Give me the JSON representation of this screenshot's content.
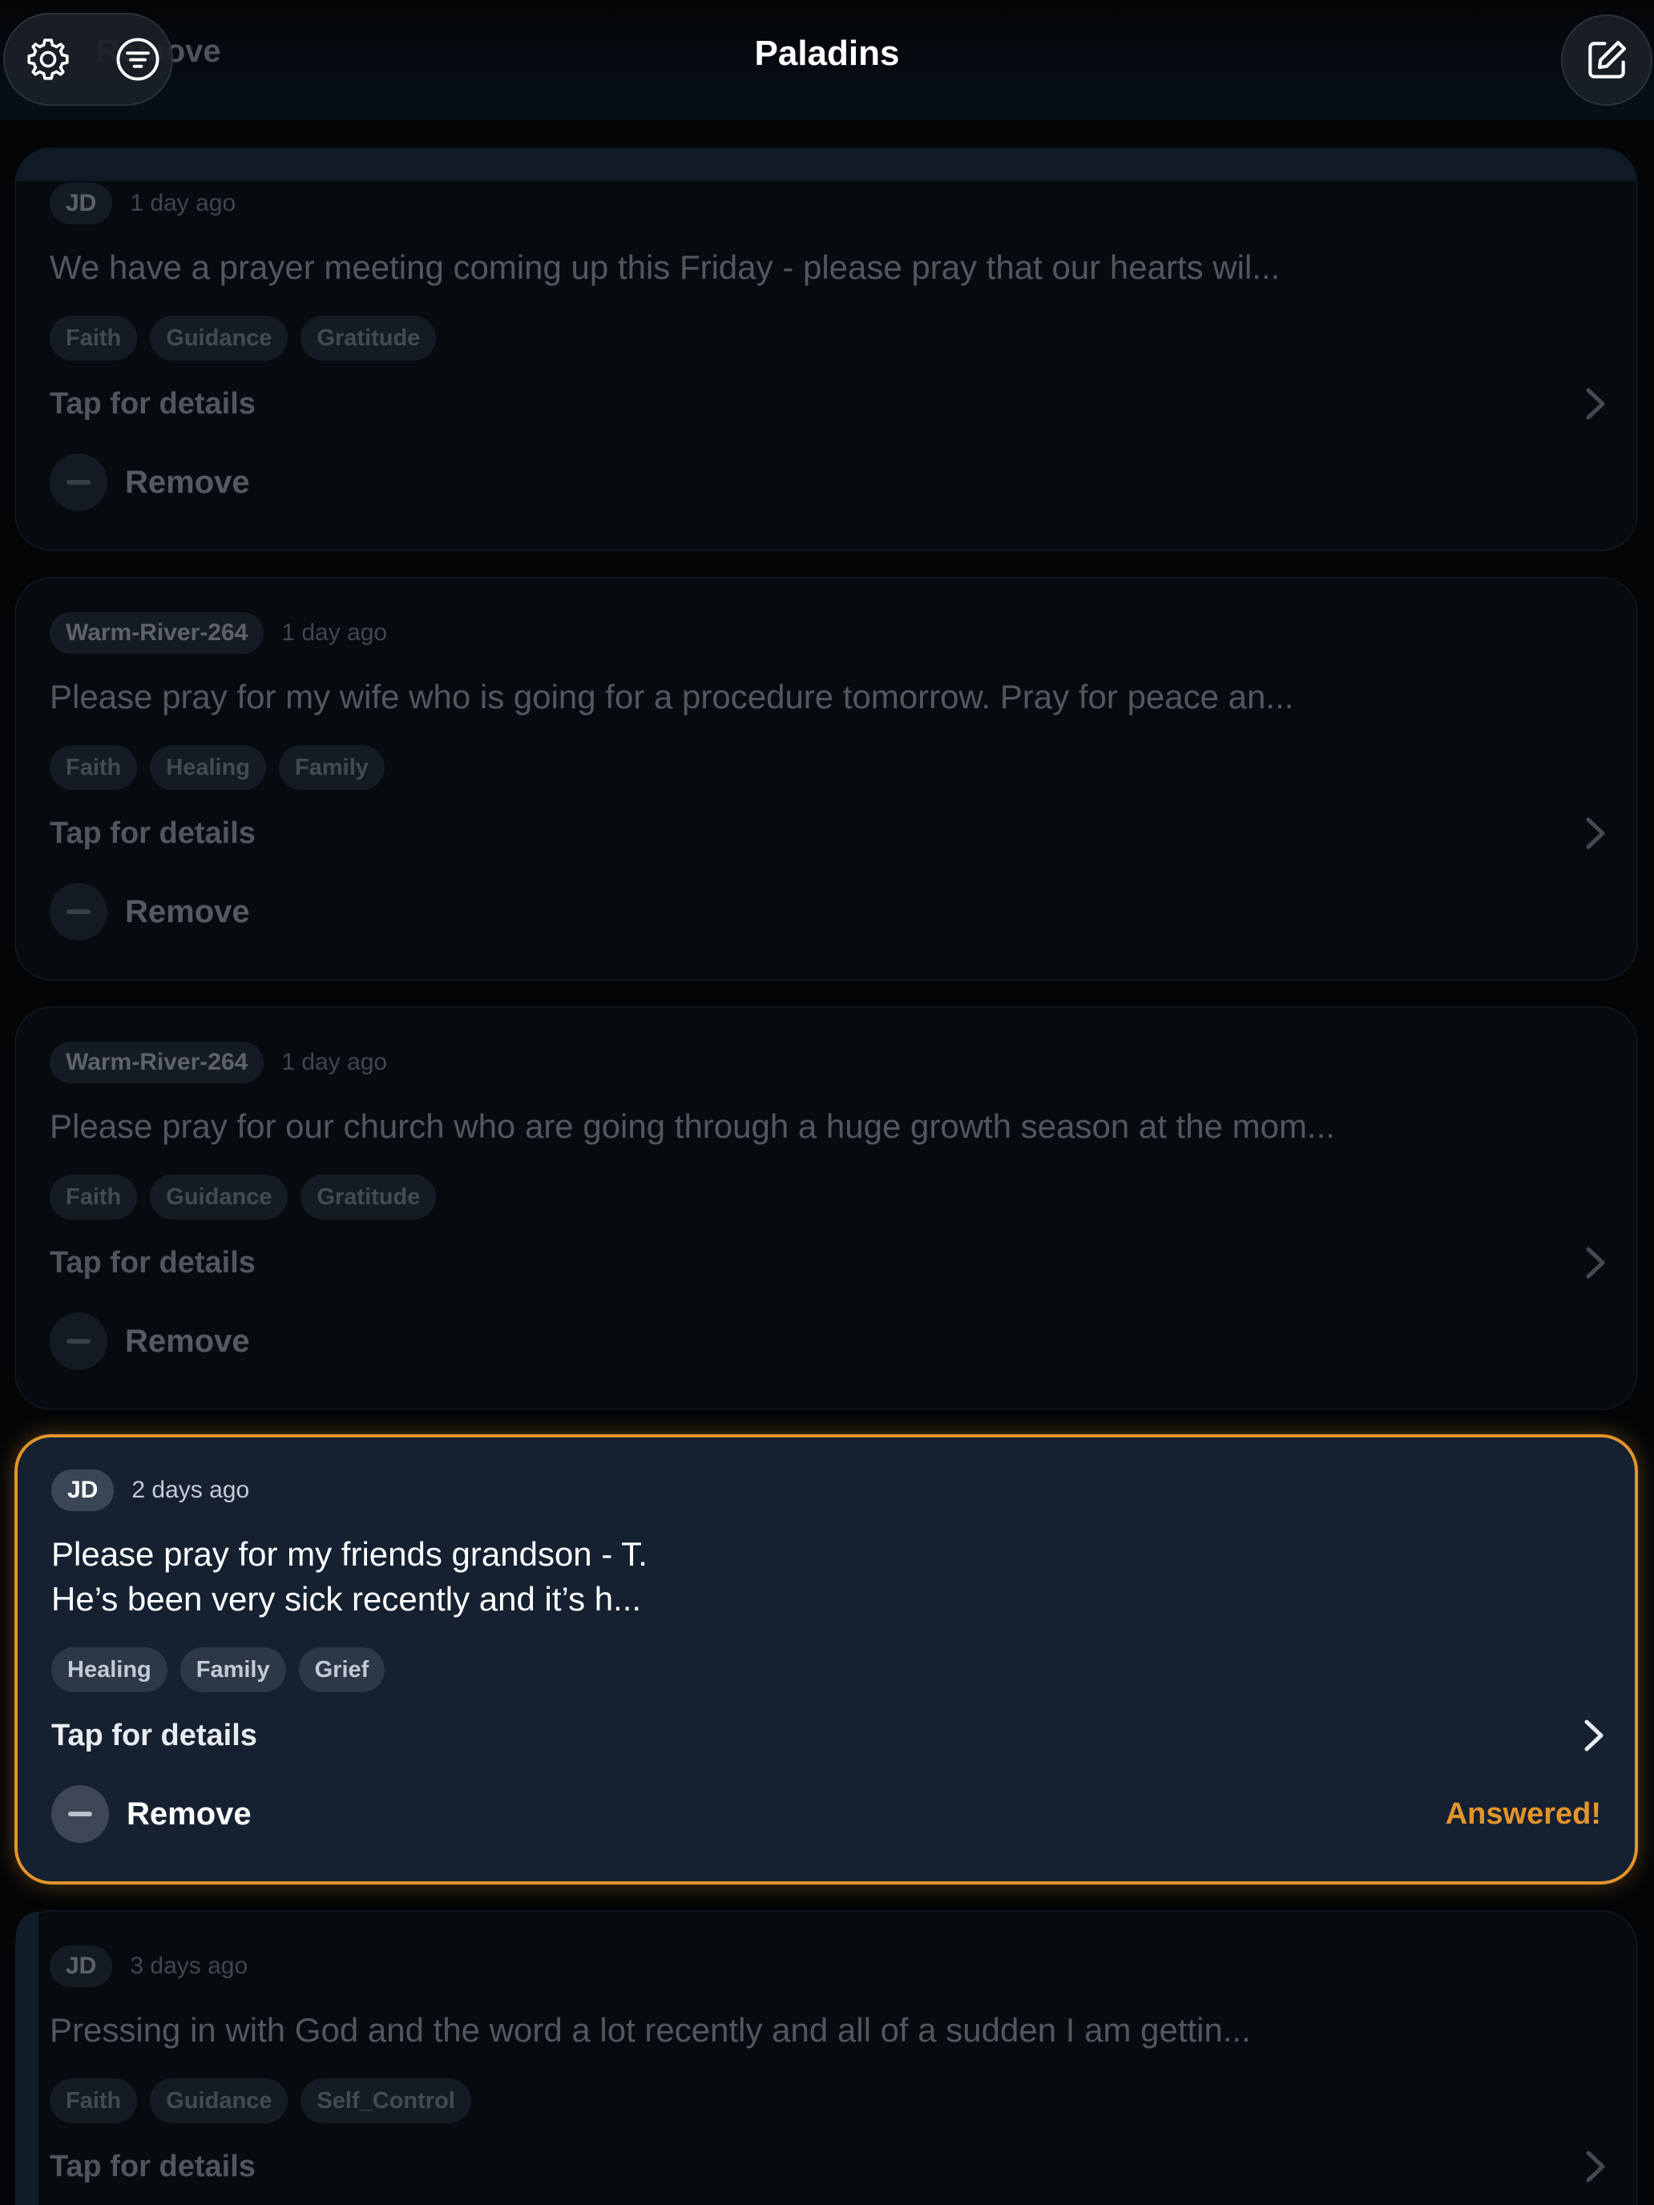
{
  "header": {
    "title": "Paladins",
    "ghost_text": "Remove",
    "settings_icon": "gear-icon",
    "filter_icon": "filter-icon",
    "compose_icon": "compose-icon"
  },
  "colors": {
    "accent": "#e3942c",
    "background": "#030507",
    "card_highlight": "#152131"
  },
  "cards": [
    {
      "author": "JD",
      "time": "1 day ago",
      "text": "We have a prayer meeting coming up this Friday - please pray that our hearts wil...",
      "tags": [
        "Faith",
        "Guidance",
        "Gratitude"
      ],
      "details_label": "Tap for details",
      "remove_label": "Remove",
      "state": "dimmed"
    },
    {
      "author": "Warm-River-264",
      "time": "1 day ago",
      "text": "Please pray for my wife who is going for a procedure tomorrow. Pray for peace an...",
      "tags": [
        "Faith",
        "Healing",
        "Family"
      ],
      "details_label": "Tap for details",
      "remove_label": "Remove",
      "state": "dimmed"
    },
    {
      "author": "Warm-River-264",
      "time": "1 day ago",
      "text": "Please pray for our church who are going through a huge growth season at the mom...",
      "tags": [
        "Faith",
        "Guidance",
        "Gratitude"
      ],
      "details_label": "Tap for details",
      "remove_label": "Remove",
      "state": "dimmed"
    },
    {
      "author": "JD",
      "time": "2 days ago",
      "text": "Please pray for my friends grandson - T.\nHe’s been very sick recently and it’s h...",
      "tags": [
        "Healing",
        "Family",
        "Grief"
      ],
      "details_label": "Tap for details",
      "remove_label": "Remove",
      "status": "Answered!",
      "state": "highlighted"
    },
    {
      "author": "JD",
      "time": "3 days ago",
      "text": "Pressing in with God and the word a lot recently and all of a sudden I am gettin...",
      "tags": [
        "Faith",
        "Guidance",
        "Self_Control"
      ],
      "details_label": "Tap for details",
      "state": "dimmed"
    }
  ]
}
